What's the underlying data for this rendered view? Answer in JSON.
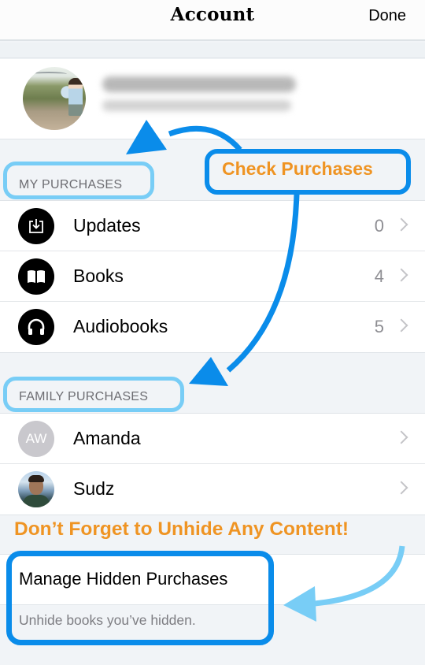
{
  "navbar": {
    "title": "Account",
    "done_label": "Done"
  },
  "profile": {
    "name": "Amanda Whittenberger",
    "email": "xxxxxxxxx@gmail.com",
    "name_blurred": true
  },
  "my_purchases": {
    "header": "MY PURCHASES",
    "items": [
      {
        "label": "Updates",
        "count": "0",
        "icon": "download-tray-icon"
      },
      {
        "label": "Books",
        "count": "4",
        "icon": "open-book-icon"
      },
      {
        "label": "Audiobooks",
        "count": "5",
        "icon": "headphones-icon"
      }
    ]
  },
  "family_purchases": {
    "header": "FAMILY PURCHASES",
    "members": [
      {
        "label": "Amanda",
        "initials": "AW",
        "avatar": "initials"
      },
      {
        "label": "Sudz",
        "avatar": "photo"
      }
    ]
  },
  "hidden_purchases": {
    "label": "Manage Hidden Purchases",
    "footer": "Unhide books you’ve hidden."
  },
  "annotations": {
    "check_purchases": "Check Purchases",
    "unhide_reminder": "Don’t Forget to Unhide Any Content!",
    "colors": {
      "callout_text": "#ef9423",
      "arrow_dark": "#0a8cea",
      "arrow_light": "#78cdf6"
    }
  }
}
